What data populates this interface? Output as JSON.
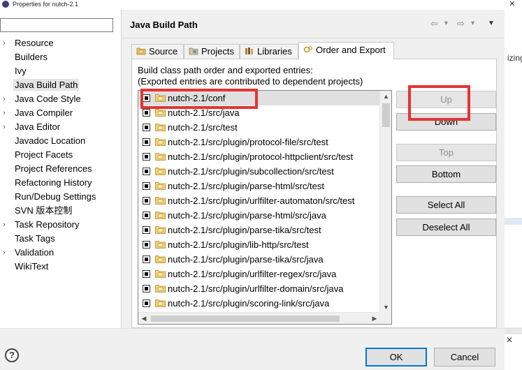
{
  "window": {
    "title": "Properties for nutch-2.1",
    "close_label": "✕"
  },
  "filter": {
    "value": "",
    "placeholder": ""
  },
  "nav": {
    "items": [
      {
        "label": "Resource",
        "expandable": true,
        "selected": false
      },
      {
        "label": "Builders",
        "expandable": false,
        "selected": false
      },
      {
        "label": "Ivy",
        "expandable": false,
        "selected": false
      },
      {
        "label": "Java Build Path",
        "expandable": false,
        "selected": true
      },
      {
        "label": "Java Code Style",
        "expandable": true,
        "selected": false
      },
      {
        "label": "Java Compiler",
        "expandable": true,
        "selected": false
      },
      {
        "label": "Java Editor",
        "expandable": true,
        "selected": false
      },
      {
        "label": "Javadoc Location",
        "expandable": false,
        "selected": false
      },
      {
        "label": "Project Facets",
        "expandable": false,
        "selected": false
      },
      {
        "label": "Project References",
        "expandable": false,
        "selected": false
      },
      {
        "label": "Refactoring History",
        "expandable": false,
        "selected": false
      },
      {
        "label": "Run/Debug Settings",
        "expandable": false,
        "selected": false
      },
      {
        "label": "SVN 版本控制",
        "expandable": false,
        "selected": false
      },
      {
        "label": "Task Repository",
        "expandable": true,
        "selected": false
      },
      {
        "label": "Task Tags",
        "expandable": false,
        "selected": false
      },
      {
        "label": "Validation",
        "expandable": true,
        "selected": false
      },
      {
        "label": "WikiText",
        "expandable": false,
        "selected": false
      }
    ]
  },
  "page": {
    "title": "Java Build Path",
    "history": {
      "back": "⇦",
      "back_menu": "▾",
      "forward": "⇨",
      "forward_menu": "▾",
      "view_menu": "▼"
    }
  },
  "tabs": [
    {
      "label": "Source",
      "icon": "source-folder-icon",
      "active": false
    },
    {
      "label": "Projects",
      "icon": "projects-icon",
      "active": false
    },
    {
      "label": "Libraries",
      "icon": "libraries-icon",
      "active": false
    },
    {
      "label": "Order and Export",
      "icon": "order-export-icon",
      "active": true
    }
  ],
  "order_export": {
    "desc_line1": "Build class path order and exported entries:",
    "desc_line2": "(Exported entries are contributed to dependent projects)",
    "entries": [
      {
        "label": "nutch-2.1/conf",
        "checked": true,
        "selected": true
      },
      {
        "label": "nutch-2.1/src/java",
        "checked": true,
        "selected": false
      },
      {
        "label": "nutch-2.1/src/test",
        "checked": true,
        "selected": false
      },
      {
        "label": "nutch-2.1/src/plugin/protocol-file/src/test",
        "checked": true,
        "selected": false
      },
      {
        "label": "nutch-2.1/src/plugin/protocol-httpclient/src/test",
        "checked": true,
        "selected": false
      },
      {
        "label": "nutch-2.1/src/plugin/subcollection/src/test",
        "checked": true,
        "selected": false
      },
      {
        "label": "nutch-2.1/src/plugin/parse-html/src/test",
        "checked": true,
        "selected": false
      },
      {
        "label": "nutch-2.1/src/plugin/urlfilter-automaton/src/test",
        "checked": true,
        "selected": false
      },
      {
        "label": "nutch-2.1/src/plugin/parse-html/src/java",
        "checked": true,
        "selected": false
      },
      {
        "label": "nutch-2.1/src/plugin/parse-tika/src/test",
        "checked": true,
        "selected": false
      },
      {
        "label": "nutch-2.1/src/plugin/lib-http/src/test",
        "checked": true,
        "selected": false
      },
      {
        "label": "nutch-2.1/src/plugin/parse-tika/src/java",
        "checked": true,
        "selected": false
      },
      {
        "label": "nutch-2.1/src/plugin/urlfilter-regex/src/java",
        "checked": true,
        "selected": false
      },
      {
        "label": "nutch-2.1/src/plugin/urlfilter-domain/src/java",
        "checked": true,
        "selected": false
      },
      {
        "label": "nutch-2.1/src/plugin/scoring-link/src/java",
        "checked": true,
        "selected": false
      }
    ],
    "buttons": {
      "up": "Up",
      "down": "Down",
      "top": "Top",
      "bottom": "Bottom",
      "select_all": "Select All",
      "deselect_all": "Deselect All"
    },
    "scroll": {
      "up": "▲",
      "down": "▼",
      "left": "◀",
      "right": "▶"
    }
  },
  "footer": {
    "help": "?",
    "ok": "OK",
    "cancel": "Cancel"
  },
  "right_strip": {
    "text_fragment": "izing"
  },
  "colors": {
    "highlight_red": "#e53333",
    "selection_gray": "#e0e0e0",
    "default_button_border": "#0078d7"
  }
}
